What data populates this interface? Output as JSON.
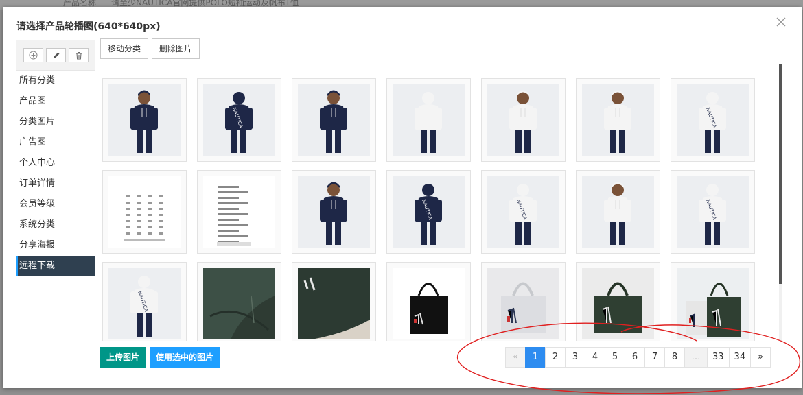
{
  "background_form": {
    "field_label": "产品名称",
    "field_value": "请至少NAUTICA官网提供POLO短袖运动及帆布T恤"
  },
  "modal": {
    "title": "请选择产品轮播图(640*640px)",
    "close_icon": "close-icon"
  },
  "sidebar": {
    "tool_icons": [
      "add-icon",
      "edit-icon",
      "trash-icon"
    ],
    "categories": [
      {
        "label": "所有分类"
      },
      {
        "label": "产品图"
      },
      {
        "label": "分类图片"
      },
      {
        "label": "广告图"
      },
      {
        "label": "个人中心"
      },
      {
        "label": "订单详情"
      },
      {
        "label": "会员等级"
      },
      {
        "label": "系统分类"
      },
      {
        "label": "分享海报"
      },
      {
        "label": "远程下载",
        "active": true
      }
    ]
  },
  "toolbar": {
    "move_label": "移动分类",
    "delete_label": "删除图片"
  },
  "images": [
    {
      "kind": "hoodie-navy-front"
    },
    {
      "kind": "hoodie-navy-back",
      "text": "NAUTICA"
    },
    {
      "kind": "hoodie-navy-side"
    },
    {
      "kind": "hoodie-white-back-full"
    },
    {
      "kind": "hoodie-white-side"
    },
    {
      "kind": "hoodie-white-front"
    },
    {
      "kind": "hoodie-white-back-full",
      "text": "NAUTICA"
    },
    {
      "kind": "size-table"
    },
    {
      "kind": "text-notes"
    },
    {
      "kind": "navy-full-body"
    },
    {
      "kind": "hoodie-navy-back",
      "text": "NAUTICA"
    },
    {
      "kind": "hoodie-white-back-full",
      "text": "NAUTICA"
    },
    {
      "kind": "hoodie-white-front-full"
    },
    {
      "kind": "hoodie-white-back-full",
      "text": "NAUTICA"
    },
    {
      "kind": "hoodie-white-back-full",
      "text": "NAUTICA"
    },
    {
      "kind": "green-fabric"
    },
    {
      "kind": "green-fabric-logo"
    },
    {
      "kind": "tote-black"
    },
    {
      "kind": "tote-white"
    },
    {
      "kind": "tote-green"
    },
    {
      "kind": "tote-group"
    }
  ],
  "footer": {
    "upload_label": "上传图片",
    "use_selected_label": "使用选中的图片"
  },
  "pagination": {
    "prev": "«",
    "pages": [
      "1",
      "2",
      "3",
      "4",
      "5",
      "6",
      "7",
      "8"
    ],
    "current": "1",
    "ellipsis": "…",
    "tail_pages": [
      "33",
      "34"
    ],
    "next": "»"
  },
  "colors": {
    "upload_button": "#009688",
    "use_button": "#1e9fff",
    "active_page": "#2d8cf0",
    "active_category": "#2f4050",
    "annotation": "#e02020"
  }
}
